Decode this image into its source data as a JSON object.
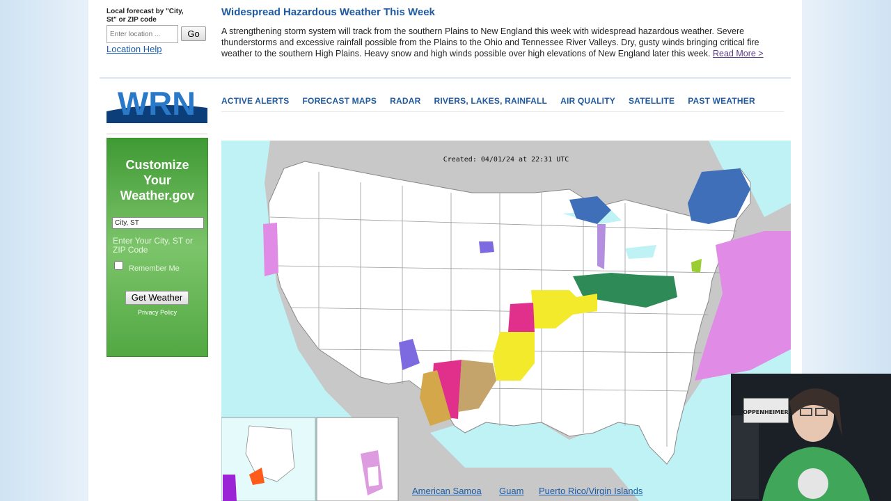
{
  "search": {
    "label": "Local forecast by \"City, St\" or ZIP code",
    "placeholder": "Enter location ...",
    "go_label": "Go",
    "help_link": "Location Help"
  },
  "headline": {
    "title": "Widespread Hazardous Weather This Week",
    "body": "A strengthening storm system will track from the southern Plains to New England this week with widespread hazardous weather. Severe thunderstorms and excessive rainfall possible from the Plains to the Ohio and Tennessee River Valleys. Dry, gusty winds bringing critical fire weather to the southern High Plains. Heavy snow and high winds possible over high elevations of New England later this week.",
    "read_more": "Read More >"
  },
  "logo": {
    "text": "WRN"
  },
  "nav": {
    "items": [
      "ACTIVE ALERTS",
      "FORECAST MAPS",
      "RADAR",
      "RIVERS, LAKES, RAINFALL",
      "AIR QUALITY",
      "SATELLITE",
      "PAST WEATHER"
    ]
  },
  "promo": {
    "title": "Customize Your Weather.gov",
    "input_value": "City, ST",
    "hint": "Enter Your City, ST or ZIP Code",
    "remember": "Remember Me",
    "button": "Get Weather",
    "privacy": "Privacy Policy"
  },
  "map": {
    "created": "Created: 04/01/24 at 22:31 UTC",
    "territory_links": [
      "American Samoa",
      "Guam",
      "Puerto Rico/Virgin Islands"
    ],
    "colors": {
      "ocean": "#bff2f4",
      "land": "#ffffff",
      "foreign": "#c8c8c8",
      "winter": "#3e6fb8",
      "flood": "#2e8b57",
      "wind": "#f2ea2a",
      "fire": "#e0308c",
      "freeze": "#7d6ae0",
      "marine": "#e08be6"
    }
  },
  "webcam": {
    "sign_text": "OPPENHEIMER"
  }
}
